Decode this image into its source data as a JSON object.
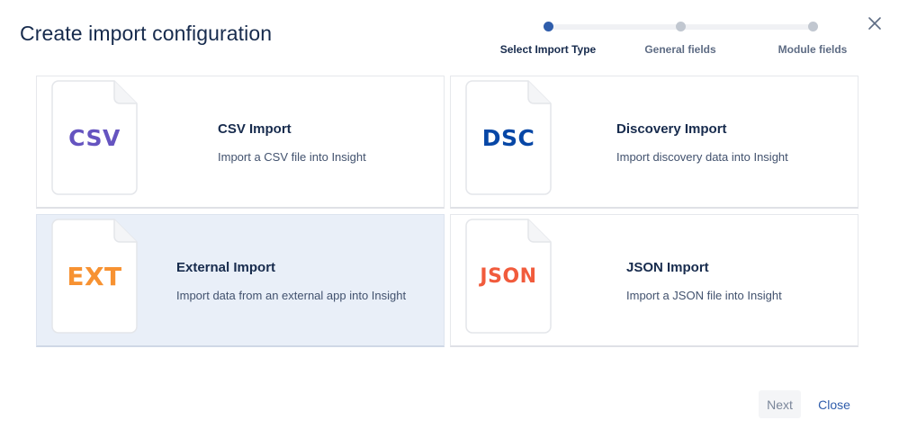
{
  "dialog": {
    "title": "Create import configuration"
  },
  "stepper": {
    "steps": [
      {
        "label": "Select Import Type",
        "active": true
      },
      {
        "label": "General fields",
        "active": false
      },
      {
        "label": "Module fields",
        "active": false
      }
    ]
  },
  "options": [
    {
      "badge": "CSV",
      "badge_color": "#6554c0",
      "title": "CSV Import",
      "description": "Import a CSV file into Insight",
      "selected": false
    },
    {
      "badge": "DSC",
      "badge_color": "#0747a6",
      "title": "Discovery Import",
      "description": "Import discovery data into Insight",
      "selected": false
    },
    {
      "badge": "EXT",
      "badge_color": "#f79232",
      "title": "External Import",
      "description": "Import data from an external app into Insight",
      "selected": true
    },
    {
      "badge": "JSON",
      "badge_color": "#f15b3c",
      "title": "JSON Import",
      "description": "Import a JSON file into Insight",
      "selected": false
    }
  ],
  "footer": {
    "next_label": "Next",
    "close_label": "Close"
  },
  "colors": {
    "accent": "#2f5dab",
    "selected_bg": "#e9eff8"
  },
  "icons": {
    "close": "close-icon",
    "file": "file-icon"
  }
}
